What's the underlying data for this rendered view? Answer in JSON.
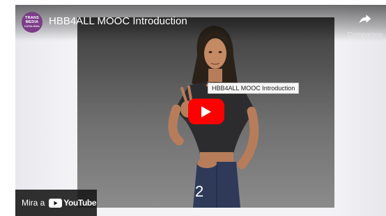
{
  "player": {
    "title": "HBB4ALL MOOC Introduction",
    "channel_avatar_lines": [
      "TRANS",
      "MEDIA",
      "CATALONIA"
    ],
    "share_label": "Comparteix",
    "tooltip": "HBB4ALL MOOC Introduction",
    "subtitle_number": "2",
    "watch_on_label": "Mira a",
    "youtube_logo_text": "YouTube",
    "accent_color": "#ff0000",
    "avatar_color": "#7b3d87"
  }
}
